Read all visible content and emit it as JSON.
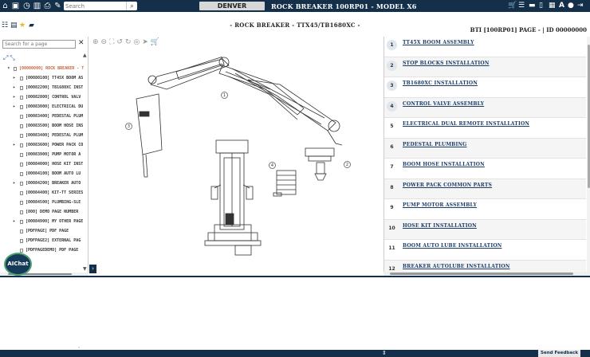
{
  "header": {
    "search_placeholder": "Search",
    "location": "DENVER",
    "document_title": "ROCK BREAKER 100RP01 - MODEL X6"
  },
  "toolbar": {
    "subtitle": "- ROCK BREAKER - TTX45/TB1680XC -",
    "page_info": "BTI [100RP01]   PAGE - | ID 00000000"
  },
  "left_panel": {
    "search_placeholder": "Search for a page",
    "tree": [
      {
        "label": "[00000000] ROCK BREAKER - T",
        "root": true,
        "caret": "▾"
      },
      {
        "label": "[00080100] TT45X BOOM AS",
        "caret": "▸"
      },
      {
        "label": "[00082200] TB1680XC INST",
        "caret": "▸"
      },
      {
        "label": "[00082800] CONTROL VALV",
        "caret": "▸"
      },
      {
        "label": "[00083000] ELECTRICAL DU",
        "caret": "▸"
      },
      {
        "label": "[00083400] PEDESTAL PLUM",
        "caret": ""
      },
      {
        "label": "[00083500] BOOM HOSE INS",
        "caret": ""
      },
      {
        "label": "[00083400] PEDESTAL PLUM",
        "caret": ""
      },
      {
        "label": "[00083600] POWER PACK CO",
        "caret": "▸"
      },
      {
        "label": "[00083900] PUMP MOTOR A",
        "caret": ""
      },
      {
        "label": "[00084000] HOSE KIT INST",
        "caret": ""
      },
      {
        "label": "[00084100] BOOM AUTO LU",
        "caret": ""
      },
      {
        "label": "[00084200] BREAKER AUTO",
        "caret": "▸"
      },
      {
        "label": "[00084400] KIT-TT SERIES",
        "caret": ""
      },
      {
        "label": "[00084500] PLUMBING-SLE",
        "caret": ""
      },
      {
        "label": "[800] DEMO PAGE NUMBER",
        "caret": ""
      },
      {
        "label": "[00084900] MY OTHER PAGE",
        "caret": "▸"
      },
      {
        "label": "[PDFPAGE] PDF PAGE",
        "caret": ""
      },
      {
        "label": "[PDFPAGE2] EXTERNAL PAG",
        "caret": ""
      },
      {
        "label": "[PDFPAGEDEMO] PDF PAGE",
        "caret": ""
      }
    ]
  },
  "aichat_label": "AIChat",
  "callouts": [
    "1",
    "2",
    "3",
    "4"
  ],
  "parts_list": [
    {
      "num": "1",
      "title": "TT45X BOOM ASSEMBLY"
    },
    {
      "num": "2",
      "title": "STOP BLOCKS INSTALLATION"
    },
    {
      "num": "3",
      "title": "TB1680XC INSTALLATION"
    },
    {
      "num": "4",
      "title": "CONTROL VALVE ASSEMBLY"
    },
    {
      "num": "5",
      "title": "ELECTRICAL DUAL REMOTE INSTALLATION"
    },
    {
      "num": "6",
      "title": "PEDESTAL PLUMBING"
    },
    {
      "num": "7",
      "title": "BOOM HOSE INSTALLATION"
    },
    {
      "num": "8",
      "title": "POWER PACK COMMON PARTS"
    },
    {
      "num": "9",
      "title": "PUMP MOTOR ASSEMBLY"
    },
    {
      "num": "10",
      "title": "HOSE KIT INSTALLATION"
    },
    {
      "num": "11",
      "title": "BOOM AUTO LUBE INSTALLATION"
    },
    {
      "num": "12",
      "title": "BREAKER AUTOLUBE INSTALLATION"
    }
  ],
  "footer": {
    "feedback_label": "Send Feedback",
    "center_icon": "⇕"
  }
}
